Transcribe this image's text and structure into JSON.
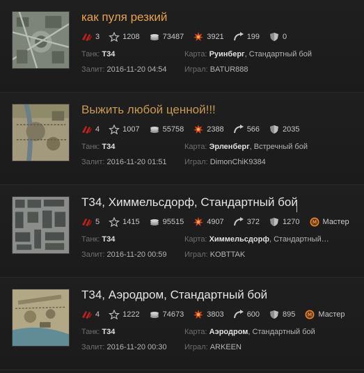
{
  "labels": {
    "tank": "Танк:",
    "map": "Карта:",
    "uploaded": "Залит:",
    "played": "Играл:"
  },
  "replays": [
    {
      "title": "как пуля резкий",
      "stats": {
        "kills": "3",
        "xp": "1208",
        "credits": "73487",
        "damage": "3921",
        "assist": "199",
        "blocked": "0"
      },
      "tank": "Т34",
      "map_name": "Руинберг",
      "mode": ", Стандартный бой",
      "date": "2016-11-20 04:54",
      "player": "BATUR888"
    },
    {
      "title": "Выжить любой ценной!!!",
      "stats": {
        "kills": "4",
        "xp": "1007",
        "credits": "55758",
        "damage": "2388",
        "assist": "566",
        "blocked": "2035"
      },
      "tank": "Т34",
      "map_name": "Эрленберг",
      "mode": ", Встречный бой",
      "date": "2016-11-20 01:51",
      "player": "DimonChiK9384"
    },
    {
      "title": "Т34, Химмельсдорф, Стандартный бой",
      "stats": {
        "kills": "5",
        "xp": "1415",
        "credits": "95515",
        "damage": "4907",
        "assist": "372",
        "blocked": "1270",
        "badge": "Мастер"
      },
      "tank": "Т34",
      "map_name": "Химмельсдорф",
      "mode": ", Стандартный…",
      "date": "2016-11-20 00:59",
      "player": "KOBTTAK"
    },
    {
      "title": "Т34, Аэродром, Стандартный бой",
      "stats": {
        "kills": "4",
        "xp": "1222",
        "credits": "74673",
        "damage": "3803",
        "assist": "600",
        "blocked": "895",
        "badge": "Мастер"
      },
      "tank": "Т34",
      "map_name": "Аэродром",
      "mode": ", Стандартный бой",
      "date": "2016-11-20 00:30",
      "player": "ARKEEN"
    }
  ],
  "colors": {
    "title_accent": "#e7a34a",
    "title_plain": "#e4e4e4",
    "kill_icon": "#c0201c",
    "damage_icon": "#e04a1a",
    "badge_gold": "#d4882a",
    "background": "#1d1d1d"
  },
  "icons": [
    "kills-icon",
    "xp-star-icon",
    "credits-icon",
    "damage-icon",
    "assist-icon",
    "blocked-shield-icon",
    "master-badge-icon"
  ]
}
